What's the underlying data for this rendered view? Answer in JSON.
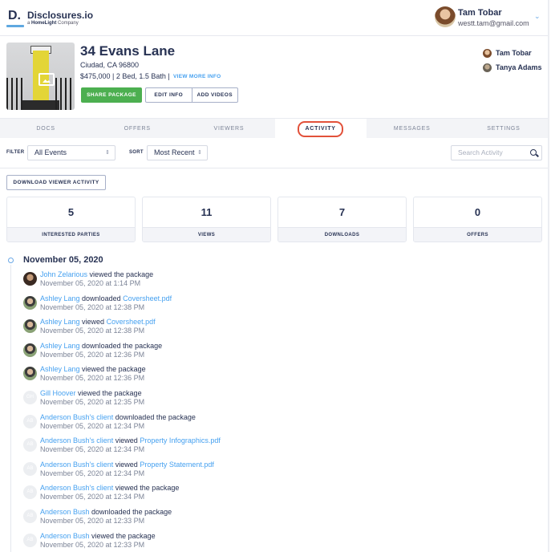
{
  "brand": {
    "mark": "D.",
    "title": "Disclosures.io",
    "subtitle_prefix": "a ",
    "subtitle_brand": "HomeLight",
    "subtitle_suffix": " Company"
  },
  "user": {
    "name": "Tam Tobar",
    "email": "westt.tam@gmail.com"
  },
  "property": {
    "title": "34 Evans Lane",
    "city": "Ciudad, CA 96800",
    "details": "$475,000 | 2 Bed, 1.5 Bath |",
    "view_more": "VIEW MORE INFO",
    "share_button": "SHARE PACKAGE",
    "edit_button": "EDIT INFO",
    "videos_button": "ADD VIDEOS",
    "agents": [
      {
        "name": "Tam Tobar"
      },
      {
        "name": "Tanya Adams"
      }
    ]
  },
  "tabs": [
    {
      "label": "DOCS",
      "active": false
    },
    {
      "label": "OFFERS",
      "active": false
    },
    {
      "label": "VIEWERS",
      "active": false
    },
    {
      "label": "ACTIVITY",
      "active": true
    },
    {
      "label": "MESSAGES",
      "active": false
    },
    {
      "label": "SETTINGS",
      "active": false
    }
  ],
  "filters": {
    "filter_label": "FILTER",
    "filter_value": "All Events",
    "sort_label": "SORT",
    "sort_value": "Most Recent",
    "search_placeholder": "Search Activity"
  },
  "download_button": "DOWNLOAD VIEWER ACTIVITY",
  "stats": [
    {
      "value": "5",
      "label": "INTERESTED PARTIES"
    },
    {
      "value": "11",
      "label": "VIEWS"
    },
    {
      "value": "7",
      "label": "DOWNLOADS"
    },
    {
      "value": "0",
      "label": "OFFERS"
    }
  ],
  "timeline": {
    "date": "November 05, 2020",
    "events": [
      {
        "actor": "John Zelarious",
        "action": " viewed the package",
        "target": "",
        "time": "November 05, 2020 at 1:14 PM",
        "avatar": "photo-john",
        "initials": ""
      },
      {
        "actor": "Ashley Lang",
        "action": " downloaded ",
        "target": "Coversheet.pdf",
        "time": "November 05, 2020 at 12:38 PM",
        "avatar": "photo-ashley",
        "initials": ""
      },
      {
        "actor": "Ashley Lang",
        "action": " viewed ",
        "target": "Coversheet.pdf",
        "time": "November 05, 2020 at 12:38 PM",
        "avatar": "photo-ashley",
        "initials": ""
      },
      {
        "actor": "Ashley Lang",
        "action": " downloaded the package",
        "target": "",
        "time": "November 05, 2020 at 12:36 PM",
        "avatar": "photo-ashley",
        "initials": ""
      },
      {
        "actor": "Ashley Lang",
        "action": " viewed the package",
        "target": "",
        "time": "November 05, 2020 at 12:36 PM",
        "avatar": "photo-ashley",
        "initials": ""
      },
      {
        "actor": "Gill Hoover",
        "action": " viewed the package",
        "target": "",
        "time": "November 05, 2020 at 12:35 PM",
        "avatar": "initials",
        "initials": "GH"
      },
      {
        "actor": "Anderson Bush's client",
        "action": " downloaded the package",
        "target": "",
        "time": "November 05, 2020 at 12:34 PM",
        "avatar": "initials",
        "initials": "AB"
      },
      {
        "actor": "Anderson Bush's client",
        "action": " viewed ",
        "target": "Property Infographics.pdf",
        "time": "November 05, 2020 at 12:34 PM",
        "avatar": "initials",
        "initials": "AB"
      },
      {
        "actor": "Anderson Bush's client",
        "action": " viewed ",
        "target": "Property Statement.pdf",
        "time": "November 05, 2020 at 12:34 PM",
        "avatar": "initials",
        "initials": "AB"
      },
      {
        "actor": "Anderson Bush's client",
        "action": " viewed the package",
        "target": "",
        "time": "November 05, 2020 at 12:34 PM",
        "avatar": "initials",
        "initials": "AB"
      },
      {
        "actor": "Anderson Bush",
        "action": " downloaded the package",
        "target": "",
        "time": "November 05, 2020 at 12:33 PM",
        "avatar": "initials",
        "initials": "AB"
      },
      {
        "actor": "Anderson Bush",
        "action": " viewed the package",
        "target": "",
        "time": "November 05, 2020 at 12:33 PM",
        "avatar": "initials",
        "initials": "AB"
      }
    ]
  },
  "colors": {
    "accent_blue": "#46a1f0",
    "share_green": "#4caf50",
    "activity_highlight": "#e2513a",
    "text_dark": "#273253"
  }
}
